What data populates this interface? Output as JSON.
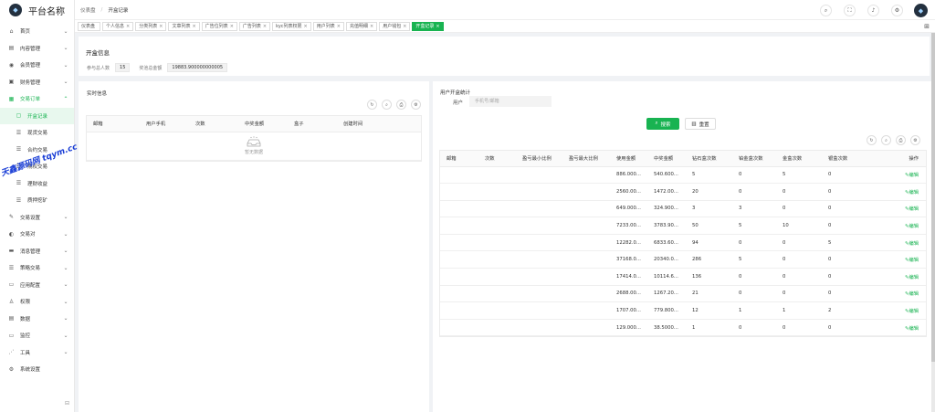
{
  "app": {
    "title": "平台名称"
  },
  "sidebar": {
    "items": [
      {
        "label": "首页",
        "icon": "home-icon",
        "glyph": "⌂",
        "caret": "⌄",
        "state": ""
      },
      {
        "label": "内容管理",
        "icon": "file-icon",
        "glyph": "▤",
        "caret": "⌄",
        "state": ""
      },
      {
        "label": "会员管理",
        "icon": "user-icon",
        "glyph": "◉",
        "caret": "⌄",
        "state": ""
      },
      {
        "label": "财务管理",
        "icon": "wallet-icon",
        "glyph": "▣",
        "caret": "⌄",
        "state": ""
      },
      {
        "label": "交易订单",
        "icon": "order-icon",
        "glyph": "▦",
        "caret": "⌃",
        "state": "active-parent"
      },
      {
        "label": "开盒记录",
        "icon": "record-icon",
        "glyph": "▢",
        "caret": "",
        "state": "sub active"
      },
      {
        "label": "现货交易",
        "icon": "list-icon",
        "glyph": "☰",
        "caret": "",
        "state": "sub"
      },
      {
        "label": "合约交易",
        "icon": "list-icon",
        "glyph": "☰",
        "caret": "",
        "state": "sub"
      },
      {
        "label": "期权交易",
        "icon": "list-icon",
        "glyph": "☰",
        "caret": "",
        "state": "sub"
      },
      {
        "label": "理财收益",
        "icon": "list-icon",
        "glyph": "☰",
        "caret": "",
        "state": "sub"
      },
      {
        "label": "质押挖矿",
        "icon": "list-icon",
        "glyph": "☰",
        "caret": "",
        "state": "sub"
      },
      {
        "label": "交易设置",
        "icon": "settings-icon",
        "glyph": "✎",
        "caret": "⌄",
        "state": ""
      },
      {
        "label": "交易对",
        "icon": "pair-icon",
        "glyph": "◐",
        "caret": "⌄",
        "state": ""
      },
      {
        "label": "消息管理",
        "icon": "message-icon",
        "glyph": "▬",
        "caret": "⌄",
        "state": ""
      },
      {
        "label": "策略交易",
        "icon": "strategy-icon",
        "glyph": "☰",
        "caret": "⌄",
        "state": ""
      },
      {
        "label": "应用配置",
        "icon": "app-icon",
        "glyph": "▭",
        "caret": "⌄",
        "state": ""
      },
      {
        "label": "权限",
        "icon": "permission-icon",
        "glyph": "♙",
        "caret": "⌄",
        "state": ""
      },
      {
        "label": "数据",
        "icon": "data-icon",
        "glyph": "▤",
        "caret": "⌄",
        "state": ""
      },
      {
        "label": "监控",
        "icon": "monitor-icon",
        "glyph": "▭",
        "caret": "⌄",
        "state": ""
      },
      {
        "label": "工具",
        "icon": "tool-icon",
        "glyph": "⋰",
        "caret": "⌄",
        "state": ""
      },
      {
        "label": "系统设置",
        "icon": "gear-icon",
        "glyph": "⚙",
        "caret": "",
        "state": ""
      }
    ]
  },
  "header": {
    "breadcrumb": [
      "仪表盘",
      "开盒记录"
    ],
    "breadcrumb_sep": "/"
  },
  "tags": [
    {
      "label": "仪表盘",
      "close": "",
      "active": false
    },
    {
      "label": "个人信息",
      "close": "×",
      "active": false
    },
    {
      "label": "分类列表",
      "close": "×",
      "active": false
    },
    {
      "label": "文章列表",
      "close": "×",
      "active": false
    },
    {
      "label": "广告位列表",
      "close": "×",
      "active": false
    },
    {
      "label": "广告列表",
      "close": "×",
      "active": false
    },
    {
      "label": "kyc列表权限",
      "close": "×",
      "active": false
    },
    {
      "label": "用户列表",
      "close": "×",
      "active": false
    },
    {
      "label": "充值明细",
      "close": "×",
      "active": false
    },
    {
      "label": "用户钱包",
      "close": "×",
      "active": false
    },
    {
      "label": "开盒记录",
      "close": "×",
      "active": true
    }
  ],
  "summary": {
    "title": "开盒信息",
    "total_label": "参与总人数",
    "total_value": "15",
    "amount_label": "奖池总金额",
    "amount_value": "19883.900000000005"
  },
  "realtime": {
    "title": "实时信息",
    "columns": [
      "邮箱",
      "用户手机",
      "次数",
      "中奖金额",
      "盒子",
      "创建时间"
    ],
    "empty_text": "暂无数据"
  },
  "stats": {
    "title": "用户开盒统计",
    "search_label": "用户",
    "search_placeholder": "手机号/邮箱",
    "search_btn": "搜索",
    "reset_btn": "重置",
    "columns": [
      "邮箱",
      "次数",
      "盈亏最小比例",
      "盈亏最大比例",
      "使用金额",
      "中奖金额",
      "钻石盒次数",
      "铂金盒次数",
      "金盒次数",
      "银盒次数",
      "操作"
    ],
    "edit_label": "编辑",
    "rows": [
      [
        "",
        "",
        "",
        "",
        "886.000...",
        "540.600...",
        "5",
        "0",
        "5",
        "0"
      ],
      [
        "",
        "",
        "",
        "",
        "2560.00...",
        "1472.00...",
        "20",
        "0",
        "0",
        "0"
      ],
      [
        "",
        "",
        "",
        "",
        "649.000...",
        "324.900...",
        "3",
        "3",
        "0",
        "0"
      ],
      [
        "",
        "",
        "",
        "",
        "7233.00...",
        "3783.90...",
        "50",
        "5",
        "10",
        "0"
      ],
      [
        "",
        "",
        "",
        "",
        "12282.0...",
        "6833.60...",
        "94",
        "0",
        "0",
        "5"
      ],
      [
        "",
        "",
        "",
        "",
        "37168.0...",
        "20340.0...",
        "286",
        "5",
        "0",
        "0"
      ],
      [
        "",
        "",
        "",
        "",
        "17414.0...",
        "10114.6...",
        "136",
        "0",
        "0",
        "0"
      ],
      [
        "",
        "",
        "",
        "",
        "2688.00...",
        "1267.20...",
        "21",
        "0",
        "0",
        "0"
      ],
      [
        "",
        "",
        "",
        "",
        "1707.00...",
        "779.800...",
        "12",
        "1",
        "1",
        "2"
      ],
      [
        "",
        "",
        "",
        "",
        "129.000...",
        "38.5000...",
        "1",
        "0",
        "0",
        "0"
      ]
    ]
  },
  "watermark": "天鑫源码网 tqym.cc",
  "colors": {
    "accent": "#18b351",
    "brand_bg": "#23303f"
  }
}
